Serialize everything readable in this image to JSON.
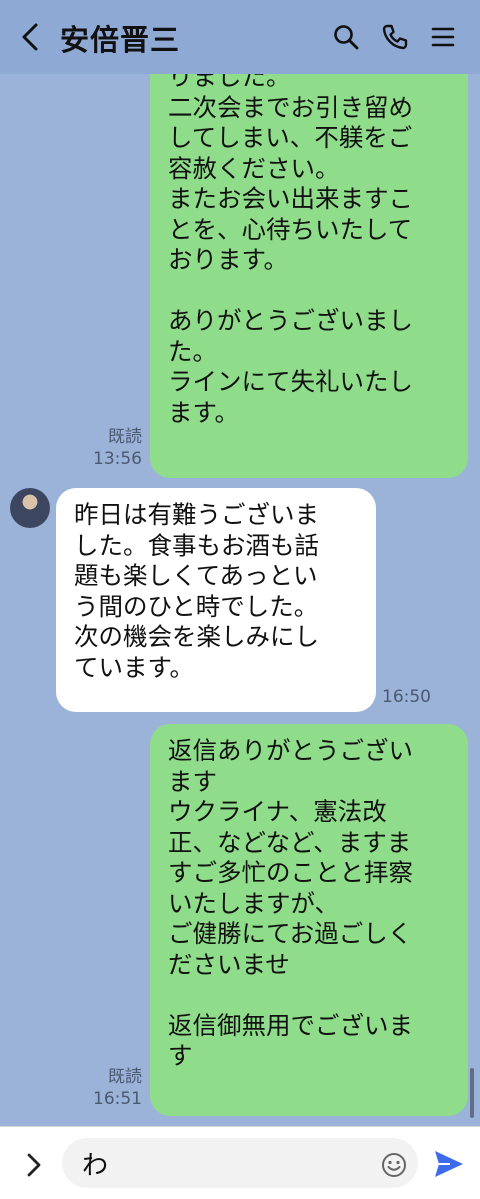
{
  "header": {
    "title": "安倍晋三",
    "icons": [
      "back-chevron-icon",
      "search-icon",
      "phone-icon",
      "menu-icon"
    ]
  },
  "messages": [
    {
      "sender": "me",
      "text": "りました。\n二次会までお引き留め\nしてしまい、不躾をご\n容赦ください。\nまたお会い出来ますこ\nとを、心待ちいたして\nおります。\n\nありがとうございまし\nた。\nラインにて失礼いたし\nます。",
      "read": "既読",
      "time": "13:56"
    },
    {
      "sender": "them",
      "text": "昨日は有難うございま\nした。食事もお酒も話\n題も楽しくてあっとい\nう間のひと時でした。\n次の機会を楽しみにし\nています。",
      "time": "16:50"
    },
    {
      "sender": "me",
      "text": "返信ありがとうござい\nます\nウクライナ、憲法改\n正、などなど、ますま\nすご多忙のことと拝察\nいたしますが、\nご健勝にてお過ごしく\nださいませ\n\n返信御無用でございま\nす",
      "read": "既読",
      "time": "16:51"
    }
  ],
  "input": {
    "value": "わ",
    "icons": [
      "expand-chevron-icon",
      "emoji-icon",
      "send-icon"
    ]
  },
  "colors": {
    "background": "#9bb2d9",
    "header": "#8fa9d5",
    "my_bubble": "#8fdd8a",
    "their_bubble": "#ffffff",
    "send_accent": "#3d6bea"
  }
}
